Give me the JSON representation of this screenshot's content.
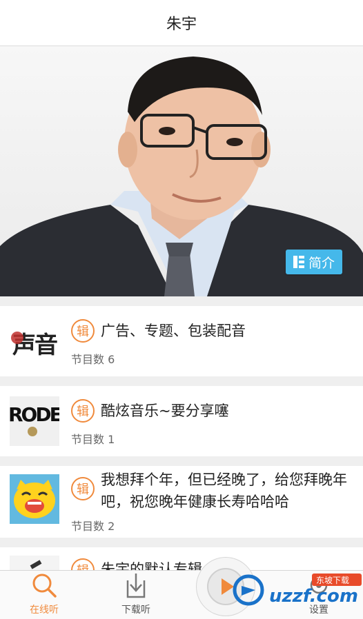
{
  "header": {
    "title": "朱宇"
  },
  "hero": {
    "intro_label": "简介"
  },
  "albums": [
    {
      "badge": "辑",
      "title": "广告、专题、包装配音",
      "count": "节目数 6",
      "thumb_text": "声音"
    },
    {
      "badge": "辑",
      "title": "酷炫音乐~要分享噻",
      "count": "节目数 1",
      "thumb_text": "RODE"
    },
    {
      "badge": "辑",
      "title": "我想拜个年，但已经晚了，给您拜晚年吧，祝您晚年健康长寿哈哈哈",
      "count": "节目数 2",
      "thumb_text": ""
    },
    {
      "badge": "辑",
      "title": "朱宇的默认专辑",
      "count": "",
      "thumb_text": ""
    }
  ],
  "tabbar": {
    "tabs": [
      {
        "label": "在线听",
        "icon": "search-icon"
      },
      {
        "label": "下载听",
        "icon": "download-icon"
      },
      {
        "label": "设置",
        "icon": "settings-icon"
      }
    ]
  },
  "watermark": {
    "text": "uzzf.com",
    "tag": "东坡下载"
  },
  "colors": {
    "accent": "#f08a3c",
    "intro": "#45b8ea"
  }
}
